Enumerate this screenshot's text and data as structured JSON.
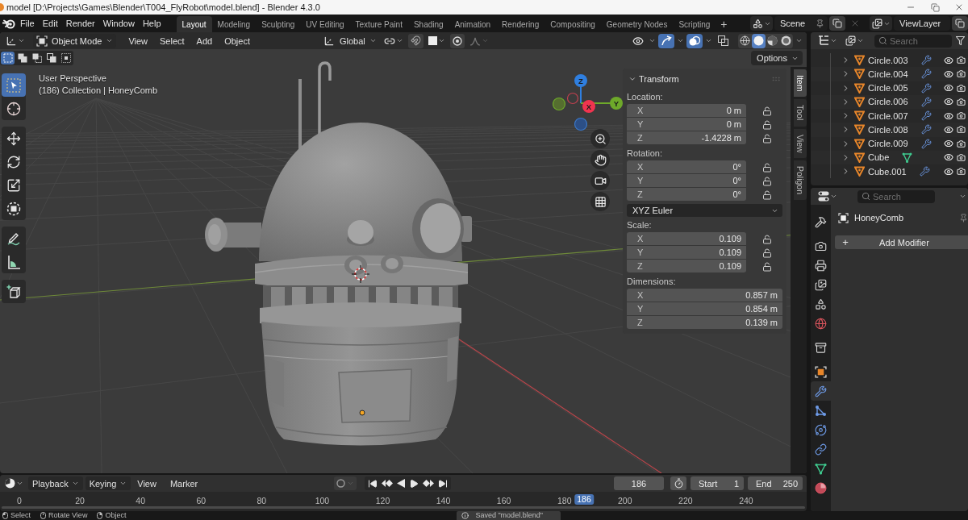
{
  "title_bar": {
    "title": "model [D:\\Projects\\Games\\Blender\\T004_FlyRobot\\model.blend] - Blender 4.3.0"
  },
  "menu": [
    "File",
    "Edit",
    "Render",
    "Window",
    "Help"
  ],
  "workspaces": [
    {
      "label": "Layout",
      "selected": true
    },
    {
      "label": "Modeling",
      "selected": false
    },
    {
      "label": "Sculpting",
      "selected": false
    },
    {
      "label": "UV Editing",
      "selected": false
    },
    {
      "label": "Texture Paint",
      "selected": false
    },
    {
      "label": "Shading",
      "selected": false
    },
    {
      "label": "Animation",
      "selected": false
    },
    {
      "label": "Rendering",
      "selected": false
    },
    {
      "label": "Compositing",
      "selected": false
    },
    {
      "label": "Geometry Nodes",
      "selected": false
    },
    {
      "label": "Scripting",
      "selected": false
    }
  ],
  "workspace_add": "+",
  "scene": {
    "name": "Scene"
  },
  "view_layer": {
    "name": "ViewLayer"
  },
  "viewport": {
    "mode": "Object Mode",
    "menus": [
      "View",
      "Select",
      "Add",
      "Object"
    ],
    "orientation": "Global",
    "toggles": [
      {
        "kind": "visibility",
        "on": false
      },
      {
        "kind": "gizmo",
        "on": true
      },
      {
        "kind": "overlay",
        "on": true
      },
      {
        "kind": "xray",
        "on": false
      }
    ],
    "shading_modes": [
      {
        "kind": "wireframe",
        "selected": false
      },
      {
        "kind": "solid",
        "selected": true
      },
      {
        "kind": "material",
        "selected": false
      },
      {
        "kind": "rendered",
        "selected": false
      }
    ],
    "select_modes": [
      {
        "kind": "new",
        "selected": true
      },
      {
        "kind": "extend",
        "selected": false
      },
      {
        "kind": "subtract",
        "selected": false
      },
      {
        "kind": "invert",
        "selected": false
      },
      {
        "kind": "intersect",
        "selected": false
      }
    ],
    "options": "Options",
    "tool_groups": [
      [
        {
          "kind": "select",
          "selected": true
        },
        {
          "kind": "cursor",
          "selected": false
        }
      ],
      [
        {
          "kind": "move",
          "selected": false
        },
        {
          "kind": "rotate",
          "selected": false
        },
        {
          "kind": "scale",
          "selected": false
        },
        {
          "kind": "transform",
          "selected": false
        }
      ],
      [
        {
          "kind": "annotate",
          "selected": false
        },
        {
          "kind": "measure",
          "selected": false
        }
      ],
      [
        {
          "kind": "add_cube",
          "selected": false
        }
      ]
    ],
    "overlay_text": [
      "User Perspective",
      "(186) Collection | HoneyComb"
    ],
    "gizmo_axes": [
      "Z",
      "Y",
      "X"
    ]
  },
  "sidebar": {
    "panel_title": "Transform",
    "sections": [
      {
        "kind": "fields",
        "label": "Location:",
        "fields": [
          {
            "axis": "X",
            "value": "0 m",
            "locked": false
          },
          {
            "axis": "Y",
            "value": "0 m",
            "locked": false
          },
          {
            "axis": "Z",
            "value": "-1.4228 m",
            "locked": false
          }
        ]
      },
      {
        "kind": "fields",
        "label": "Rotation:",
        "fields": [
          {
            "axis": "X",
            "value": "0°",
            "locked": false
          },
          {
            "axis": "Y",
            "value": "0°",
            "locked": false
          },
          {
            "axis": "Z",
            "value": "0°",
            "locked": false
          }
        ]
      },
      {
        "kind": "dropdown",
        "value": "XYZ Euler"
      },
      {
        "kind": "fields",
        "label": "Scale:",
        "fields": [
          {
            "axis": "X",
            "value": "0.109",
            "locked": false
          },
          {
            "axis": "Y",
            "value": "0.109",
            "locked": false
          },
          {
            "axis": "Z",
            "value": "0.109",
            "locked": false
          }
        ]
      },
      {
        "kind": "fields",
        "label": "Dimensions:",
        "fields": [
          {
            "axis": "X",
            "value": "0.857 m"
          },
          {
            "axis": "Y",
            "value": "0.854 m"
          },
          {
            "axis": "Z",
            "value": "0.139 m"
          }
        ]
      }
    ],
    "tabs": [
      {
        "label": "Item",
        "selected": true
      },
      {
        "label": "Tool",
        "selected": false
      },
      {
        "label": "View",
        "selected": false
      },
      {
        "label": "Poligon",
        "selected": false
      }
    ]
  },
  "outliner": {
    "search": {
      "placeholder": "Search"
    },
    "rows": [
      {
        "name": "Circle.003",
        "kind": "modifier"
      },
      {
        "name": "Circle.004",
        "kind": "modifier"
      },
      {
        "name": "Circle.005",
        "kind": "modifier"
      },
      {
        "name": "Circle.006",
        "kind": "modifier"
      },
      {
        "name": "Circle.007",
        "kind": "modifier"
      },
      {
        "name": "Circle.008",
        "kind": "modifier"
      },
      {
        "name": "Circle.009",
        "kind": "modifier"
      },
      {
        "name": "Cube",
        "kind": "mesh"
      },
      {
        "name": "Cube.001",
        "kind": "modifier"
      }
    ]
  },
  "properties": {
    "search": {
      "placeholder": "Search"
    },
    "tab_groups": [
      [
        {
          "kind": "tool",
          "selected": false
        }
      ],
      [
        {
          "kind": "render",
          "selected": false
        },
        {
          "kind": "output",
          "selected": false
        },
        {
          "kind": "view_layer",
          "selected": false
        },
        {
          "kind": "scene",
          "selected": false
        },
        {
          "kind": "world",
          "selected": false
        }
      ],
      [
        {
          "kind": "collection",
          "selected": false
        }
      ],
      [
        {
          "kind": "object",
          "selected": false
        },
        {
          "kind": "modifier",
          "selected": true
        },
        {
          "kind": "particles",
          "selected": false
        },
        {
          "kind": "physics",
          "selected": false
        },
        {
          "kind": "constraints",
          "selected": false
        },
        {
          "kind": "data",
          "selected": false
        },
        {
          "kind": "material",
          "selected": false
        }
      ]
    ],
    "object_name": "HoneyComb",
    "add_symbol": "+",
    "add_modifier": "Add Modifier"
  },
  "timeline": {
    "menus": [
      {
        "label": "Playback",
        "dropdown": true
      },
      {
        "label": "Keying",
        "dropdown": true
      },
      {
        "label": "View",
        "dropdown": false
      },
      {
        "label": "Marker",
        "dropdown": false
      }
    ],
    "current_frame": "186",
    "start": {
      "label": "Start",
      "value": "1"
    },
    "end": {
      "label": "End",
      "value": "250"
    },
    "ruler": [
      "0",
      "20",
      "40",
      "60",
      "80",
      "100",
      "120",
      "140",
      "160",
      "180",
      "200",
      "220",
      "240"
    ],
    "playhead": {
      "label": "186",
      "level": 0.724
    }
  },
  "status_bar": {
    "hints": [
      "Select",
      "Rotate View",
      "Object"
    ],
    "message": "Saved \"model.blend\""
  }
}
